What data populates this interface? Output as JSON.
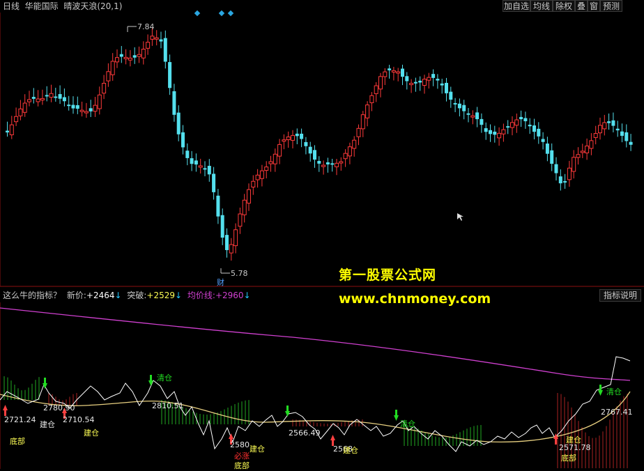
{
  "header": {
    "title_parts": [
      "日线",
      "华能国际",
      "晴波天浪(20,1)"
    ],
    "buttons": [
      "加自选",
      "均线",
      "除权",
      "叠",
      "窗",
      "预测"
    ]
  },
  "price_chart": {
    "high_label": "7.84",
    "low_label": "5.78",
    "fin_marker": "财",
    "colors": {
      "up": "#ff3a3a",
      "down": "#54e0ee"
    }
  },
  "indicator": {
    "name": "这么牛的指标？",
    "new_price_label": "新价:",
    "new_price_value": "+2464",
    "new_price_arrow": "↓",
    "breakout_label": "突破:",
    "breakout_value": "+2529",
    "breakout_arrow": "↓",
    "avg_label": "均价线:",
    "avg_value": "+2960",
    "avg_arrow": "↓",
    "help_button": "指标说明",
    "colors": {
      "avg_line": "#d040d0",
      "signal": "#22dd22",
      "cost": "#ffff55",
      "price": "#ffffff"
    }
  },
  "annotations": {
    "labels": [
      {
        "text": "2721.24",
        "cls": "white"
      },
      {
        "text": "2780.90",
        "cls": "white"
      },
      {
        "text": "建仓",
        "cls": "white"
      },
      {
        "text": "2710.54",
        "cls": "white"
      },
      {
        "text": "底部",
        "cls": "yellow"
      },
      {
        "text": "建仓",
        "cls": "yellow"
      },
      {
        "text": "清仓",
        "cls": "green"
      },
      {
        "text": "2810.51",
        "cls": "white"
      },
      {
        "text": "2580",
        "cls": "white"
      },
      {
        "text": "建仓",
        "cls": "yellow"
      },
      {
        "text": "必涨",
        "cls": "red"
      },
      {
        "text": "底部",
        "cls": "yellow"
      },
      {
        "text": "2566.49",
        "cls": "white"
      },
      {
        "text": "2568",
        "cls": "white"
      },
      {
        "text": "建仓",
        "cls": "yellow"
      },
      {
        "text": "清仓",
        "cls": "green"
      },
      {
        "text": "建仓",
        "cls": "yellow"
      },
      {
        "text": "2571.78",
        "cls": "white"
      },
      {
        "text": "底部",
        "cls": "yellow"
      },
      {
        "text": "清仓",
        "cls": "green"
      },
      {
        "text": "2767.41",
        "cls": "white"
      }
    ]
  },
  "watermark": {
    "line1": "第一股票公式网",
    "line2": "www.chnmoney.com"
  }
}
